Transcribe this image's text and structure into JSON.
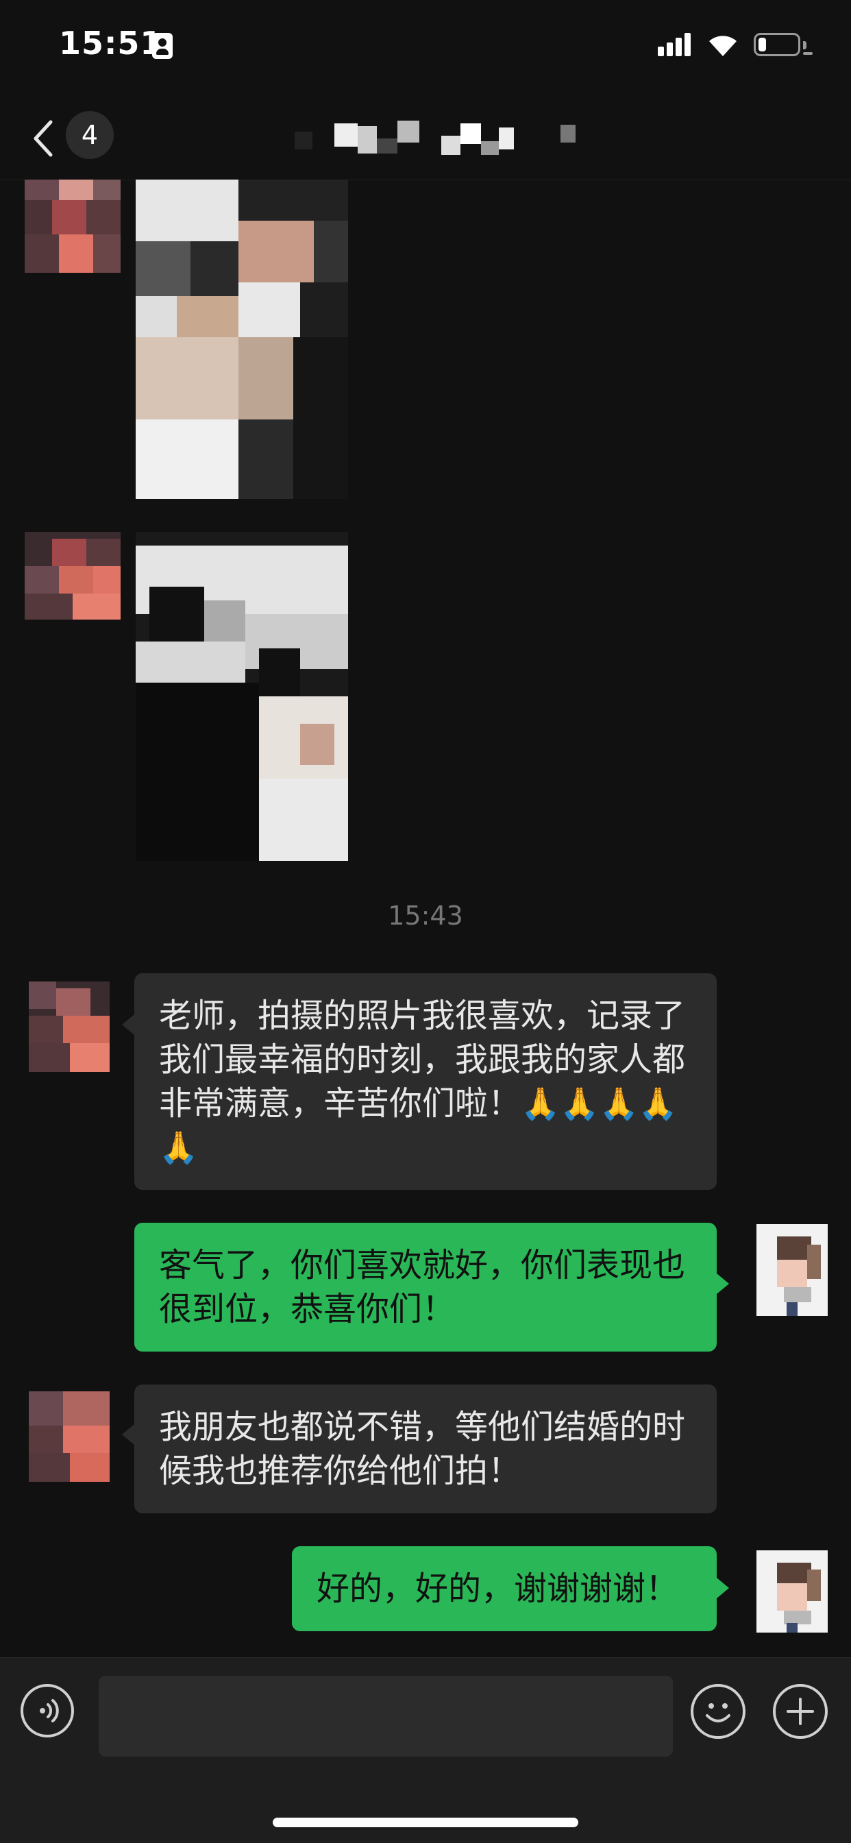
{
  "status_bar": {
    "time": "15:51",
    "icons": [
      "contact-card-icon",
      "signal-icon",
      "wifi-icon",
      "battery-icon"
    ],
    "battery_level": 0.2
  },
  "nav": {
    "back_icon": "chevron-left-icon",
    "unread_count": "4",
    "title": ""
  },
  "messages": [
    {
      "type": "image",
      "from": "contact"
    },
    {
      "type": "image",
      "from": "contact"
    },
    {
      "type": "time",
      "text": "15:43"
    },
    {
      "type": "text",
      "from": "contact",
      "text_line": "老师，拍摄的照片我很喜欢，记录了我们最幸福的时刻，我跟我的家人都非常满意，辛苦你们啦！",
      "emojis": [
        "🙏",
        "🙏",
        "🙏",
        "🙏",
        "🙏"
      ]
    },
    {
      "type": "text",
      "from": "me",
      "text": "客气了，你们喜欢就好，你们表现也很到位，恭喜你们！"
    },
    {
      "type": "text",
      "from": "contact",
      "text": "我朋友也都说不错，等他们结婚的时候我也推荐你给他们拍！"
    },
    {
      "type": "text",
      "from": "me",
      "text": "好的，好的，谢谢谢谢！"
    }
  ],
  "input_bar": {
    "voice_icon": "voice-icon",
    "emoji_icon": "emoji-icon",
    "plus_icon": "plus-icon",
    "placeholder": ""
  },
  "colors": {
    "background": "#111111",
    "incoming_bubble": "#2c2c2c",
    "outgoing_bubble": "#2ab757",
    "timestamp": "#777777"
  }
}
